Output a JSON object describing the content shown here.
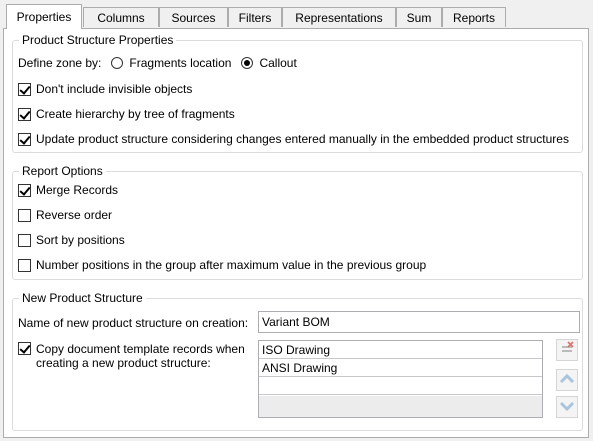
{
  "tabs": [
    "Properties",
    "Columns",
    "Sources",
    "Filters",
    "Representations",
    "Sum",
    "Reports"
  ],
  "active_tab": "Properties",
  "product_structure": {
    "title": "Product Structure Properties",
    "define_zone_label": "Define zone by:",
    "zone_options": [
      "Fragments location",
      "Callout"
    ],
    "zone_selected": "Callout",
    "options": [
      {
        "label": "Don't include invisible objects",
        "checked": true
      },
      {
        "label": "Create hierarchy by tree of fragments",
        "checked": true
      },
      {
        "label": "Update product structure considering changes entered manually in the embedded product structures",
        "checked": true
      }
    ]
  },
  "report_options": {
    "title": "Report Options",
    "options": [
      {
        "label": "Merge Records",
        "checked": true
      },
      {
        "label": "Reverse order",
        "checked": false
      },
      {
        "label": "Sort by positions",
        "checked": false
      },
      {
        "label": "Number positions in the group after maximum value in the previous group",
        "checked": false
      }
    ]
  },
  "new_product_structure": {
    "title": "New Product Structure",
    "name_label": "Name of new product structure on creation:",
    "name_value": "Variant BOM",
    "copy_label_line1": "Copy document template records when",
    "copy_label_line2": "creating a new product structure:",
    "copy_checked": true,
    "templates": [
      "ISO Drawing",
      "ANSI Drawing"
    ]
  },
  "icons": {
    "delete": "delete-icon",
    "move_up": "arrow-up-icon",
    "move_down": "arrow-down-icon"
  },
  "colors": {
    "panel_bg": "#ffffff",
    "window_bg": "#f0f0f0",
    "arrow_blue": "#a9c4dc",
    "delete_red": "#e07070"
  }
}
